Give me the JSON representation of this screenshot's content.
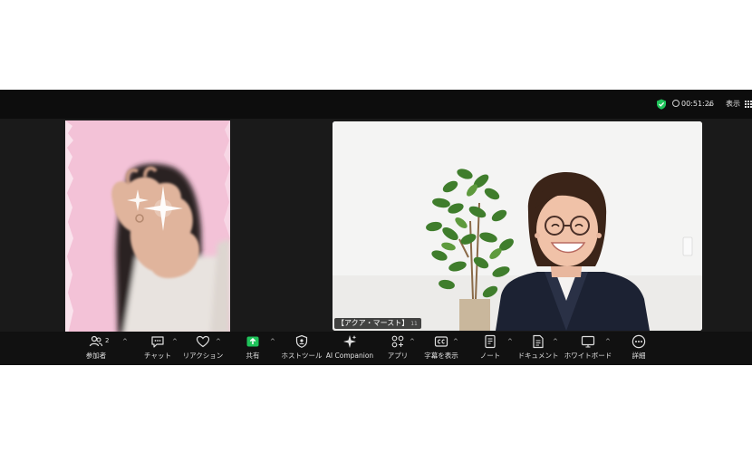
{
  "topbar": {
    "timer": "00:51:26",
    "view_label": "表示",
    "security_color": "#1fc35a",
    "icons": [
      "shield-check-icon",
      "clock-icon",
      "chevron-down-icon",
      "grid-icon"
    ]
  },
  "participants": [
    {
      "name": "",
      "video": "pink-frame-hand-sparkle"
    },
    {
      "name": "【アクア・マースト】",
      "number": "11",
      "video": "woman-glasses-smiling-plant"
    }
  ],
  "toolbar": {
    "participants_count": "2",
    "items": [
      {
        "label": "参加者",
        "icon": "participants-icon"
      },
      {
        "label": "チャット",
        "icon": "chat-icon"
      },
      {
        "label": "リアクション",
        "icon": "heart-icon"
      },
      {
        "label": "共有",
        "icon": "share-screen-icon"
      },
      {
        "label": "ホストツール",
        "icon": "host-tools-icon"
      },
      {
        "label": "AI Companion",
        "icon": "ai-sparkle-icon"
      },
      {
        "label": "アプリ",
        "icon": "apps-icon"
      },
      {
        "label": "字幕を表示",
        "icon": "captions-icon"
      },
      {
        "label": "ノート",
        "icon": "notes-icon"
      },
      {
        "label": "ドキュメント",
        "icon": "document-icon"
      },
      {
        "label": "ホワイトボード",
        "icon": "whiteboard-icon"
      },
      {
        "label": "詳細",
        "icon": "more-icon"
      }
    ],
    "share_color": "#1fc35a"
  }
}
